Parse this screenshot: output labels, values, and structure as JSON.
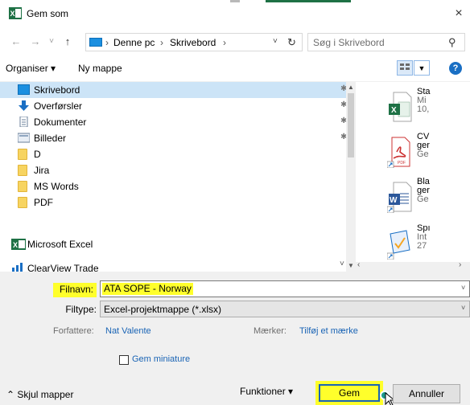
{
  "window": {
    "title": "Gem som",
    "close": "×"
  },
  "nav": {
    "back": "←",
    "forward": "→",
    "recent": "˅",
    "up": "↑",
    "breadcrumb": [
      "Denne pc",
      "Skrivebord"
    ],
    "separator": "›",
    "dropdown": "˅",
    "refresh": "↻",
    "search_placeholder": "Søg i Skrivebord"
  },
  "toolbar": {
    "organize": "Organiser ▾",
    "new_folder": "Ny mappe",
    "help": "?"
  },
  "sidebar": {
    "items": [
      {
        "label": "Skrivebord",
        "icon": "desktop-icon",
        "pinned": true,
        "selected": true
      },
      {
        "label": "Overførsler",
        "icon": "download-icon",
        "pinned": true
      },
      {
        "label": "Dokumenter",
        "icon": "documents-icon",
        "pinned": true
      },
      {
        "label": "Billeder",
        "icon": "pictures-icon",
        "pinned": true
      },
      {
        "label": "D",
        "icon": "folder-icon"
      },
      {
        "label": "Jira",
        "icon": "folder-icon"
      },
      {
        "label": "MS Words",
        "icon": "folder-icon"
      },
      {
        "label": "PDF",
        "icon": "folder-icon"
      },
      {
        "label": "Microsoft Excel",
        "icon": "excel-icon"
      },
      {
        "label": "ClearView Trade",
        "icon": "app-icon"
      }
    ],
    "pin_glyph": "📌"
  },
  "files": [
    {
      "icon": "excel-file-icon",
      "lines": [
        "Sta",
        "Mi",
        "10,"
      ]
    },
    {
      "icon": "pdf-file-icon",
      "lines": [
        "CV",
        "ger",
        "Ge"
      ]
    },
    {
      "icon": "word-file-icon",
      "lines": [
        "Bla",
        "ger",
        "Ge"
      ]
    },
    {
      "icon": "project-file-icon",
      "lines": [
        "Spı",
        "Int",
        "27"
      ]
    }
  ],
  "form": {
    "filename_label": "Filnavn:",
    "filename_value": "ATA SOPE - Norway",
    "filetype_label": "Filtype:",
    "filetype_value": "Excel-projektmappe (*.xlsx)",
    "authors_label": "Forfattere:",
    "authors_value": "Nat Valente",
    "tags_label": "Mærker:",
    "tags_value": "Tilføj et mærke",
    "thumbnail_label": "Gem miniature"
  },
  "footer": {
    "hide_folders": "Skjul mapper",
    "tools": "Funktioner",
    "save": "Gem",
    "cancel": "Annuller"
  },
  "colors": {
    "highlight": "#ffff2b",
    "selection": "#cce4f7",
    "link": "#1a64b5",
    "excel_green": "#1e7145"
  }
}
